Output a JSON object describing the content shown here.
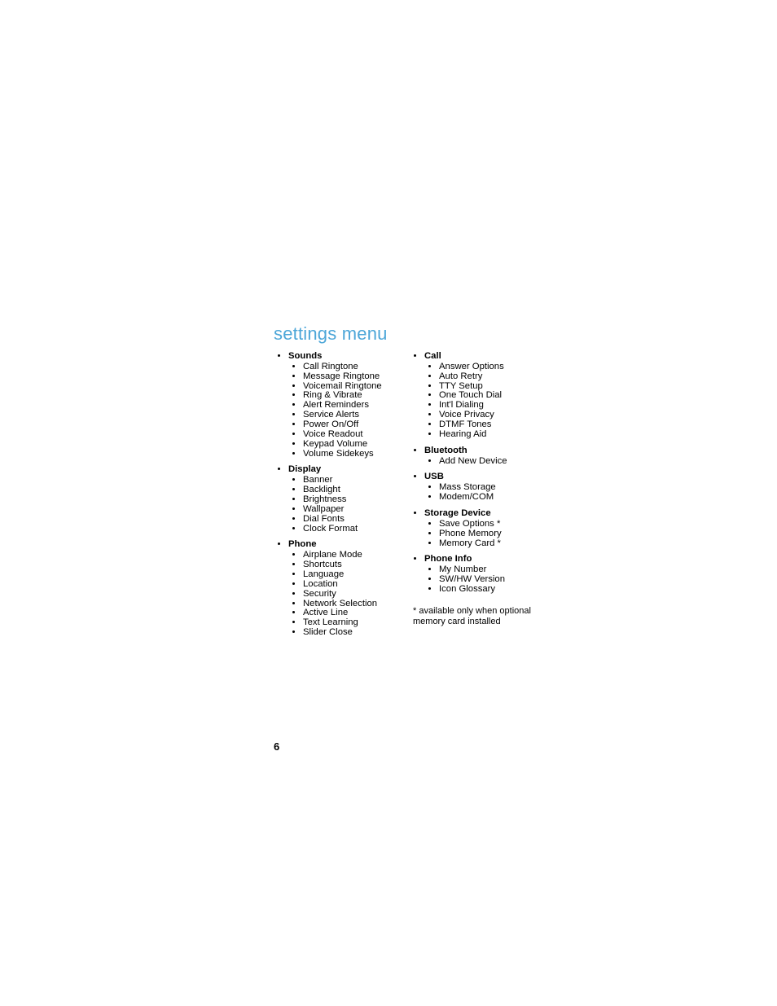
{
  "title": "settings menu",
  "page_number": "6",
  "footnote": "* available only when optional memory card installed",
  "columns": [
    {
      "sections": [
        {
          "title": "Sounds",
          "items": [
            "Call Ringtone",
            "Message Ringtone",
            "Voicemail Ringtone",
            "Ring & Vibrate",
            "Alert Reminders",
            "Service Alerts",
            "Power On/Off",
            "Voice Readout",
            "Keypad Volume",
            "Volume Sidekeys"
          ]
        },
        {
          "title": "Display",
          "items": [
            "Banner",
            "Backlight",
            "Brightness",
            "Wallpaper",
            "Dial Fonts",
            "Clock Format"
          ]
        },
        {
          "title": "Phone",
          "items": [
            "Airplane Mode",
            "Shortcuts",
            "Language",
            "Location",
            "Security",
            "Network Selection",
            "Active Line",
            "Text Learning",
            "Slider Close"
          ]
        }
      ]
    },
    {
      "sections": [
        {
          "title": "Call",
          "items": [
            "Answer Options",
            "Auto Retry",
            "TTY Setup",
            "One Touch Dial",
            "Int'l Dialing",
            "Voice Privacy",
            "DTMF Tones",
            "Hearing Aid"
          ]
        },
        {
          "title": "Bluetooth",
          "items": [
            "Add New Device"
          ]
        },
        {
          "title": "USB",
          "items": [
            "Mass Storage",
            "Modem/COM"
          ]
        },
        {
          "title": "Storage Device",
          "items": [
            "Save Options *",
            "Phone Memory",
            "Memory Card *"
          ]
        },
        {
          "title": "Phone Info",
          "items": [
            "My Number",
            "SW/HW Version",
            "Icon Glossary"
          ]
        }
      ]
    }
  ]
}
